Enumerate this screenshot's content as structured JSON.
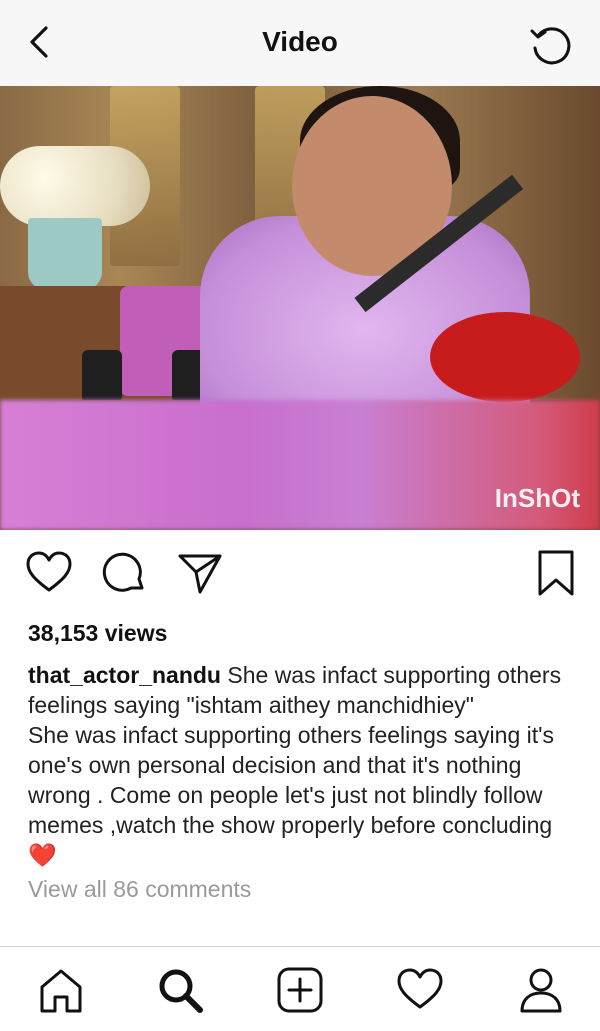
{
  "header": {
    "title": "Video",
    "back_icon": "chevron-left-icon",
    "reload_icon": "refresh-icon"
  },
  "video": {
    "watermark": "InShOt"
  },
  "actions": {
    "like_icon": "heart-icon",
    "comment_icon": "comment-icon",
    "share_icon": "paper-plane-icon",
    "save_icon": "bookmark-icon"
  },
  "post": {
    "views": "38,153 views",
    "username": "that_actor_nandu",
    "caption": "She was infact supporting others feelings saying \"ishtam aithey manchidhiey\"",
    "comment": "She was infact supporting others feelings saying it's one's own personal decision and that it's nothing wrong . Come on people let's just not blindly follow memes ,watch the show properly before concluding",
    "comment_emoji": "❤️",
    "view_all": "View all 86 comments"
  },
  "tabbar": {
    "items": [
      "home-icon",
      "search-icon",
      "add-icon",
      "activity-heart-icon",
      "profile-icon"
    ]
  },
  "colors": {
    "header_bg": "#f7f7f7",
    "heart_red": "#e3292e",
    "muted_text": "#9a9a9a"
  }
}
